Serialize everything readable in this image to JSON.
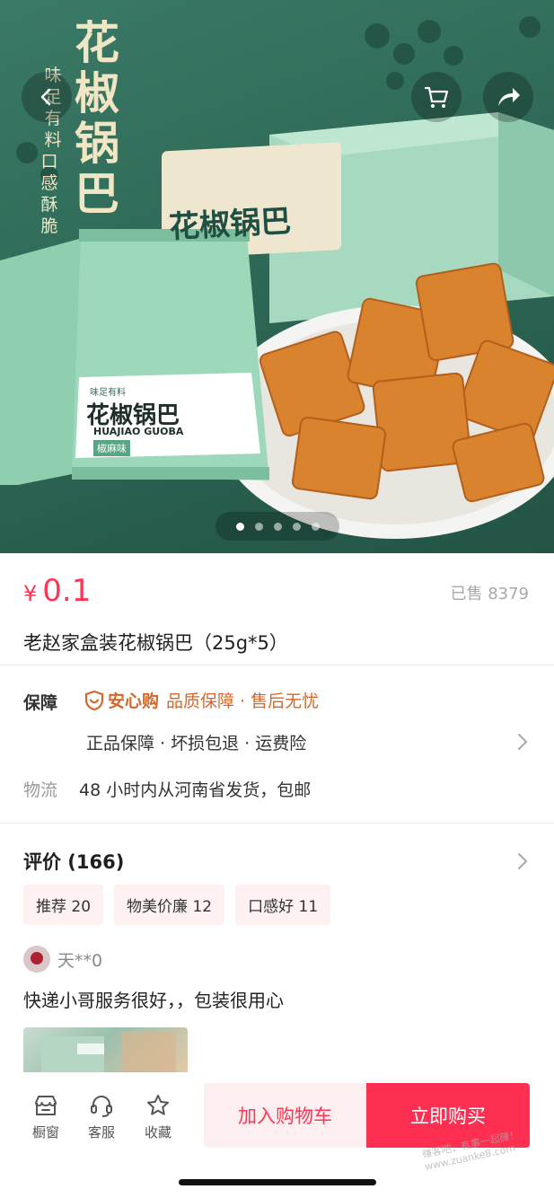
{
  "hero": {
    "title": "花椒锅巴",
    "slogan_left": "味足有料",
    "slogan_right": "口感酥脆",
    "box_title": "花椒锅巴",
    "bag_title": "花椒锅巴",
    "bag_pinyin": "HUAJIAO GUOBA",
    "bag_flavor": "椒麻味",
    "bag_top": "味足有料",
    "current_slide": 1,
    "total_slides": 5
  },
  "nav": {
    "back_icon": "chevron-left-icon",
    "cart_icon": "cart-icon",
    "share_icon": "share-icon"
  },
  "product": {
    "currency": "¥",
    "price": "0.1",
    "sold": "已售 8379",
    "title": "老赵家盒装花椒锅巴（25g*5）"
  },
  "guarantee": {
    "label": "保障",
    "brand": "安心购",
    "brand_desc": "品质保障 · 售后无忧",
    "items": "正品保障 · 坏损包退 · 运费险"
  },
  "logistics": {
    "label": "物流",
    "text": "48 小时内从河南省发货，包邮"
  },
  "reviews": {
    "title": "评价 (166)",
    "tags": [
      "推荐 20",
      "物美价廉 12",
      "口感好 11"
    ],
    "first": {
      "user": "天**0",
      "text": "快递小哥服务很好，，包装很用心"
    }
  },
  "bottom_bar": {
    "tabs": [
      {
        "label": "橱窗",
        "icon": "storefront-icon"
      },
      {
        "label": "客服",
        "icon": "headset-icon"
      },
      {
        "label": "收藏",
        "icon": "star-icon"
      }
    ],
    "add_to_cart": "加入购物车",
    "buy_now": "立即购买"
  },
  "colors": {
    "accent": "#ff2f52",
    "price": "#ff3554",
    "guarantee": "#d4672a",
    "hero_bg": "#2f6b58"
  },
  "watermark": "赚客吧，有事一起赚！www.zuanke8.com"
}
